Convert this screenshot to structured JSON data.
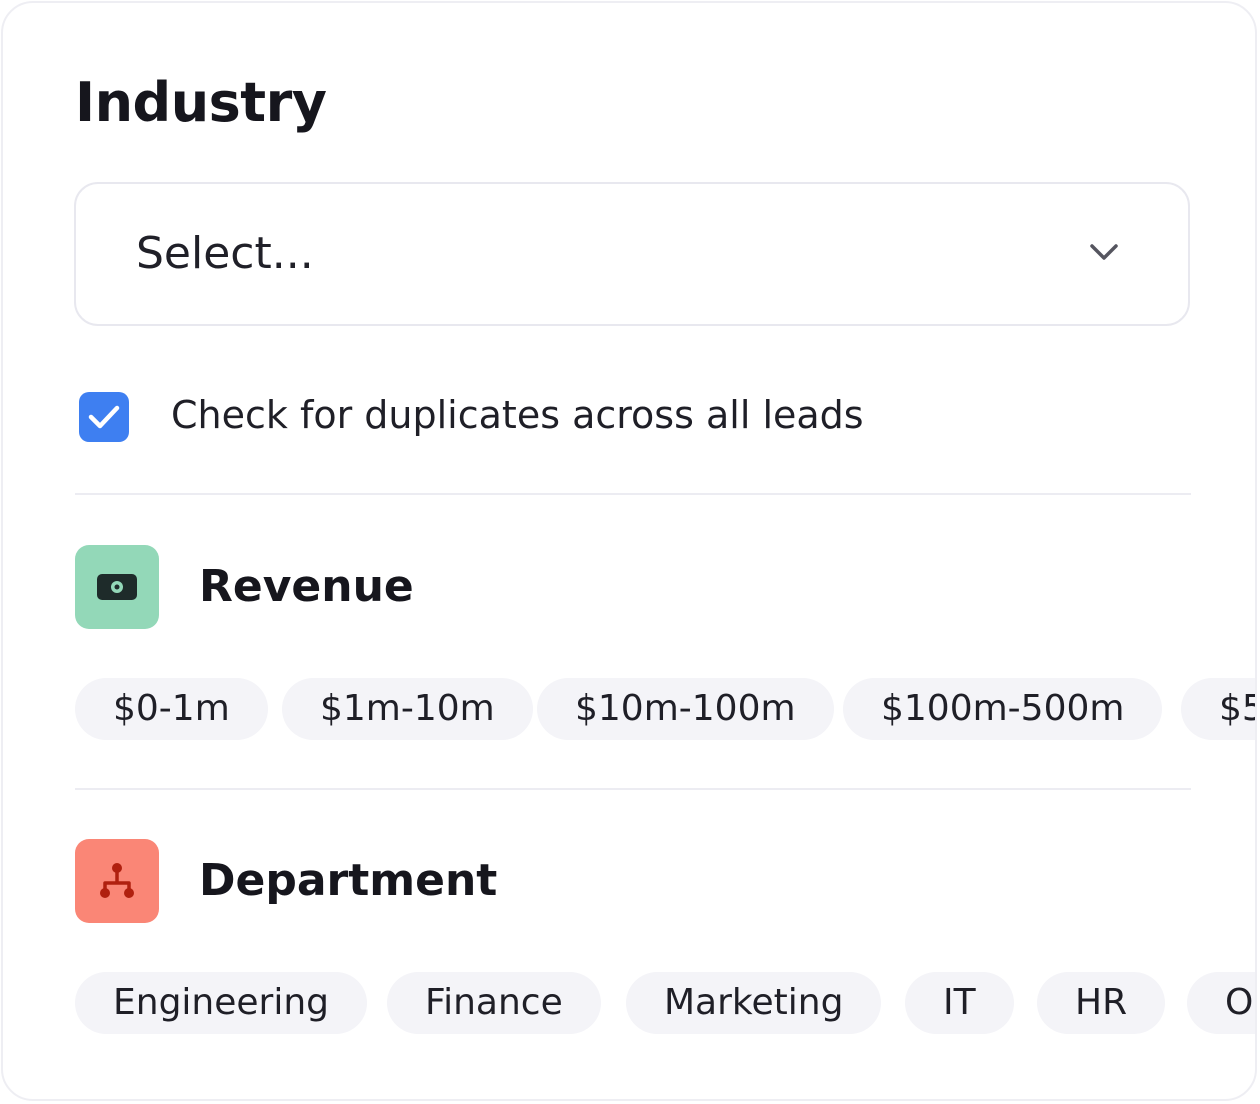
{
  "industry": {
    "title": "Industry",
    "select_placeholder": "Select..."
  },
  "duplicates": {
    "checked": true,
    "label": "Check for duplicates across all leads"
  },
  "revenue": {
    "title": "Revenue",
    "icon": "money-icon",
    "icon_bg": "#93d8b8",
    "chips": [
      "$0-1m",
      "$1m-10m",
      "$10m-100m",
      "$100m-500m",
      "$5"
    ]
  },
  "department": {
    "title": "Department",
    "icon": "org-chart-icon",
    "icon_bg": "#fa8676",
    "chips": [
      "Engineering",
      "Finance",
      "Marketing",
      "IT",
      "HR",
      "O"
    ]
  },
  "colors": {
    "accent": "#3e7ff1",
    "chip_bg": "#f4f4f8"
  }
}
